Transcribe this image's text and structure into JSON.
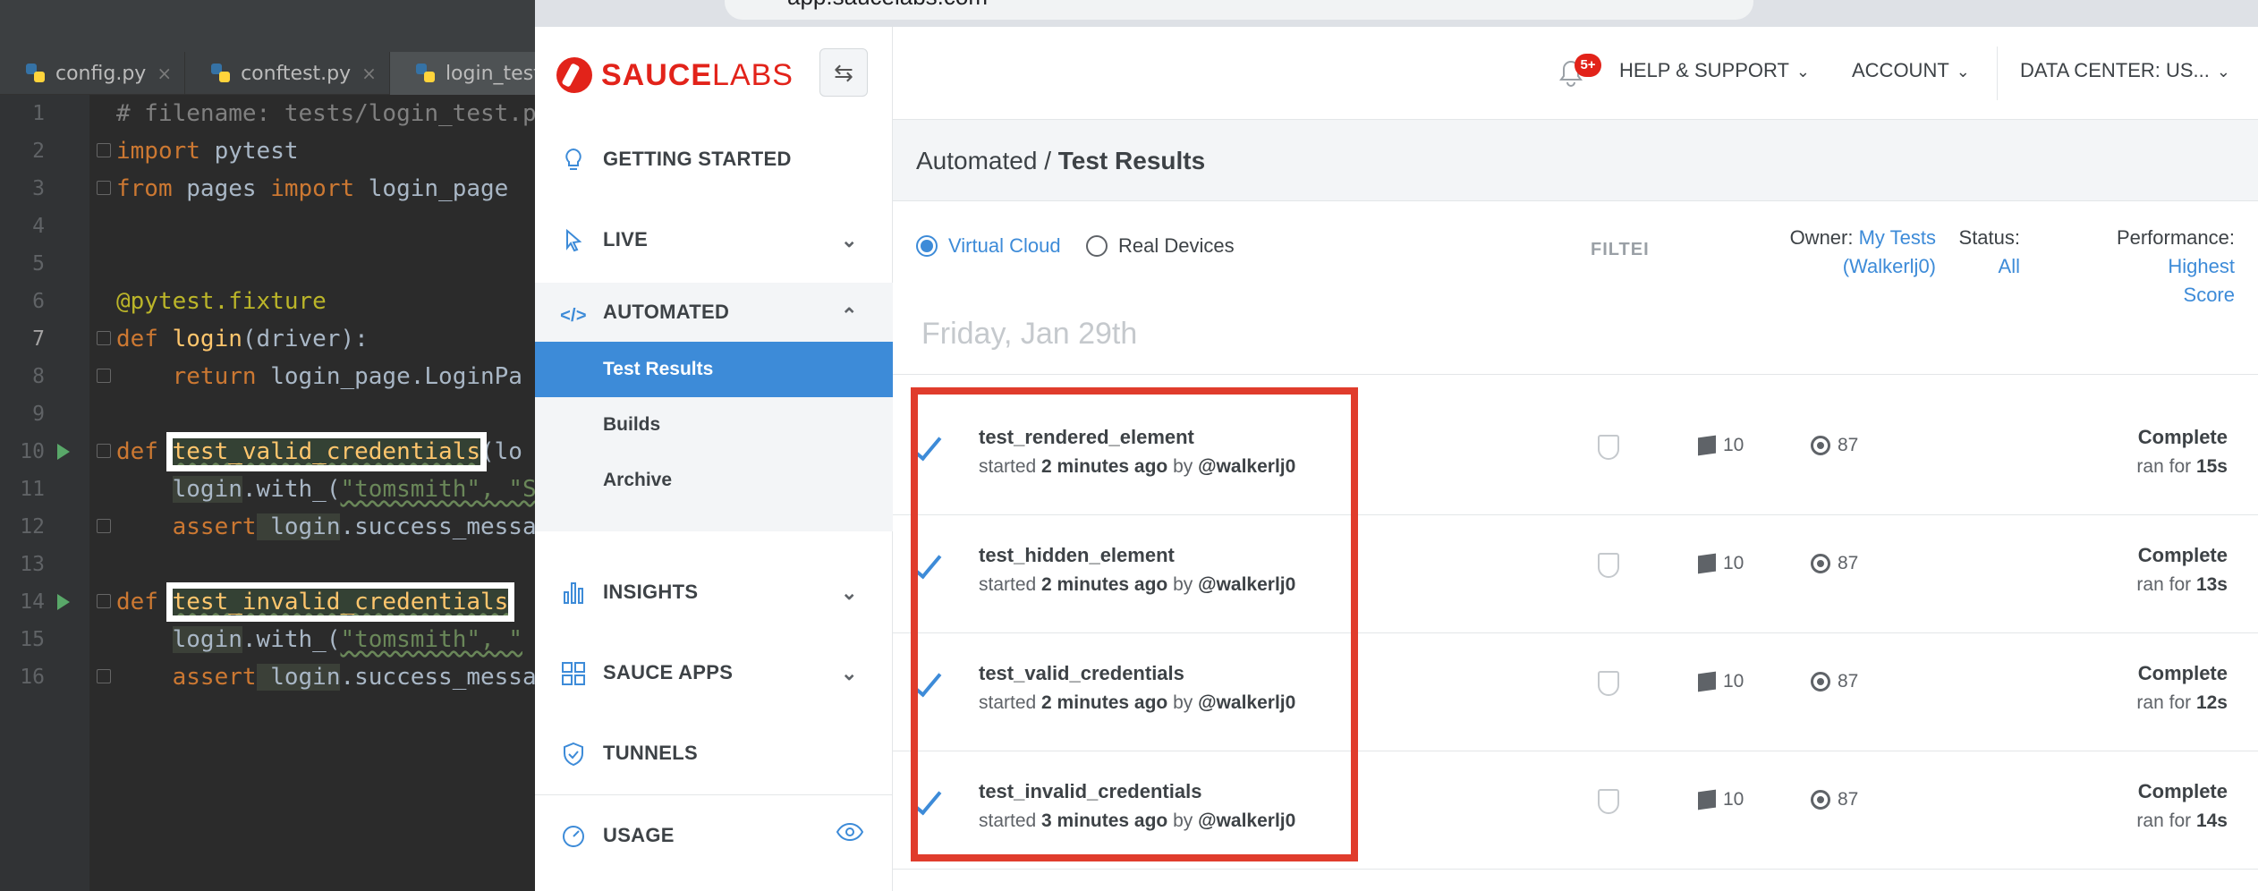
{
  "editor": {
    "tabs": [
      {
        "label": "config.py",
        "active": false
      },
      {
        "label": "conftest.py",
        "active": false
      },
      {
        "label": "login_test.",
        "active": true
      }
    ],
    "tab_close": "×",
    "lines": [
      {
        "n": "1",
        "text": "# filename: tests/login_test.p"
      },
      {
        "n": "2",
        "kw": "import",
        "rest": " pytest"
      },
      {
        "n": "3",
        "kw": "from",
        "mid": " pages ",
        "kw2": "import",
        "rest": " login_page"
      },
      {
        "n": "4"
      },
      {
        "n": "5"
      },
      {
        "n": "6",
        "decorator": "@pytest.fixture"
      },
      {
        "n": "7",
        "kw": "def",
        "fn": " login",
        "rest": "(driver):"
      },
      {
        "n": "8",
        "kw": "return",
        "rest": " login_page.LoginPa"
      },
      {
        "n": "9"
      },
      {
        "n": "10",
        "kw": "def",
        "fn": "test_valid_credentials",
        "rest": "(lo"
      },
      {
        "n": "11",
        "pre": "login",
        "rest": ".with_(",
        "str": "\"tomsmith\"",
        "tail": ", \"S"
      },
      {
        "n": "12",
        "kw": "assert",
        "pre": " login",
        "rest": ".success_messa"
      },
      {
        "n": "13"
      },
      {
        "n": "14",
        "kw": "def",
        "fn": "test_invalid_credentials",
        "rest": ""
      },
      {
        "n": "15",
        "pre": "login",
        "rest": ".with_(",
        "str": "\"tomsmith\"",
        "tail": ", \""
      },
      {
        "n": "16",
        "kw": "assert",
        "pre": " login",
        "rest": ".success_messa"
      }
    ]
  },
  "browser": {
    "url": "app.saucelabs.com"
  },
  "sidebar": {
    "logo_bold": "SAUCE",
    "logo_thin": "LABS",
    "collapse_icon": "⇆",
    "items": [
      {
        "label": "GETTING STARTED",
        "icon": "lightbulb-icon",
        "glyph": "💡"
      },
      {
        "label": "LIVE",
        "icon": "cursor-icon",
        "glyph": "↖",
        "chevron": "⌄"
      },
      {
        "label": "AUTOMATED",
        "icon": "code-icon",
        "glyph": "</>",
        "chevron": "⌃"
      },
      {
        "label": "INSIGHTS",
        "icon": "bar-chart-icon",
        "glyph": "▮",
        "chevron": "⌄"
      },
      {
        "label": "SAUCE APPS",
        "icon": "apps-grid-icon",
        "glyph": "▦",
        "chevron": "⌄"
      },
      {
        "label": "TUNNELS",
        "icon": "shield-icon",
        "glyph": "⛉"
      },
      {
        "label": "USAGE",
        "icon": "gauge-icon",
        "glyph": "◔",
        "extra": "👁"
      }
    ],
    "subitems": [
      {
        "label": "Test Results",
        "active": true
      },
      {
        "label": "Builds",
        "active": false
      },
      {
        "label": "Archive",
        "active": false
      }
    ]
  },
  "header": {
    "notification_count": "5+",
    "help": "HELP & SUPPORT",
    "account": "ACCOUNT",
    "data_center": "DATA CENTER: US...",
    "dropdown_glyph": "⌄"
  },
  "main": {
    "crumb_parent": "Automated",
    "crumb_sep": " / ",
    "crumb_current": "Test Results",
    "radio_virtual": "Virtual Cloud",
    "radio_real": "Real Devices",
    "filter_label": "FILTEI",
    "owner_label": "Owner:",
    "owner_value_1": "My Tests",
    "owner_value_2": "(Walkerlj0)",
    "status_label": "Status:",
    "status_value": "All",
    "performance_label": "Performance:",
    "performance_value_1": "Highest",
    "performance_value_2": "Score",
    "date_heading": "Friday, Jan 29th",
    "tests": [
      {
        "name": "test_rendered_element",
        "started_prefix": "started ",
        "when": "2 minutes ago",
        "by_prefix": " by ",
        "user": "@walkerlj0",
        "os_version": "10",
        "browser_version": "87",
        "status": "Complete",
        "ran_prefix": "ran for ",
        "duration": "15s"
      },
      {
        "name": "test_hidden_element",
        "started_prefix": "started ",
        "when": "2 minutes ago",
        "by_prefix": " by ",
        "user": "@walkerlj0",
        "os_version": "10",
        "browser_version": "87",
        "status": "Complete",
        "ran_prefix": "ran for ",
        "duration": "13s"
      },
      {
        "name": "test_valid_credentials",
        "started_prefix": "started ",
        "when": "2 minutes ago",
        "by_prefix": " by ",
        "user": "@walkerlj0",
        "os_version": "10",
        "browser_version": "87",
        "status": "Complete",
        "ran_prefix": "ran for ",
        "duration": "12s"
      },
      {
        "name": "test_invalid_credentials",
        "started_prefix": "started ",
        "when": "3 minutes ago",
        "by_prefix": " by ",
        "user": "@walkerlj0",
        "os_version": "10",
        "browser_version": "87",
        "status": "Complete",
        "ran_prefix": "ran for ",
        "duration": "14s"
      }
    ]
  },
  "colors": {
    "accent": "#3d8bd8",
    "brand_red": "#e2231a",
    "highlight_box": "#e03c2c"
  }
}
